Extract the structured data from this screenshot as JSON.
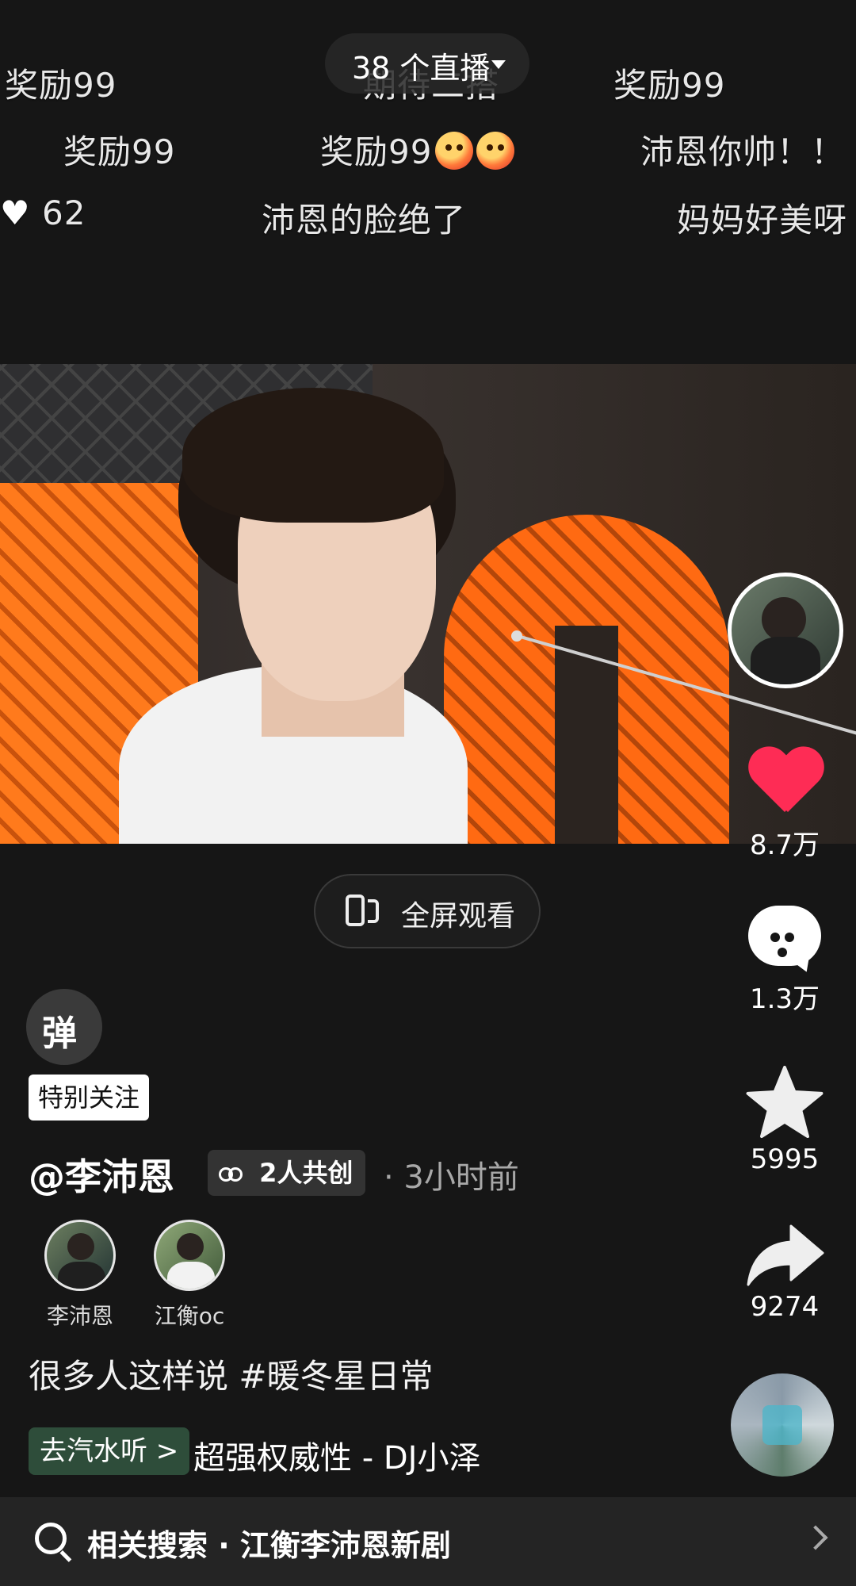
{
  "live": {
    "label": "38 个直播"
  },
  "danmaku": [
    "奖励99",
    "期待二搭",
    "奖励99",
    "奖励99",
    "奖励99",
    "沛恩你帅！！",
    "62",
    "沛恩的脸绝了",
    "妈妈好美呀"
  ],
  "fullscreen": {
    "label": "全屏观看"
  },
  "rail": {
    "likes": "8.7万",
    "comments": "1.3万",
    "favorites": "5995",
    "shares": "9274"
  },
  "info": {
    "danmu_toggle": "弹",
    "special_tag": "特别关注",
    "author": "@李沛恩",
    "cocreate": "2人共创",
    "time": "· 3小时前",
    "creators": [
      {
        "name": "李沛恩"
      },
      {
        "name": "江衡oc"
      }
    ],
    "caption": "很多人这样说  #暖冬星日常",
    "music_tag": "去汽水听 >",
    "music_title": "超强权威性 - DJ小泽"
  },
  "bottom": {
    "related_search": "相关搜索 · 江衡李沛恩新剧"
  },
  "colors": {
    "accent_like": "#fe2c55",
    "background": "#161616"
  }
}
